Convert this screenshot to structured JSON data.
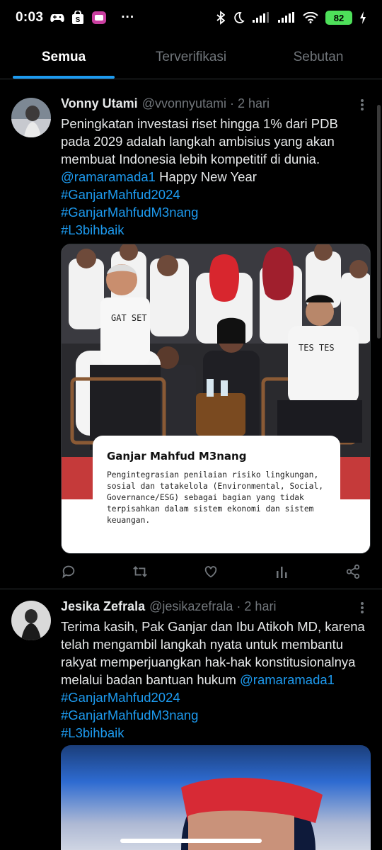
{
  "status_bar": {
    "time": "0:03",
    "battery": "82",
    "overflow": "···"
  },
  "tabs": [
    {
      "label": "Semua",
      "active": true
    },
    {
      "label": "Terverifikasi",
      "active": false
    },
    {
      "label": "Sebutan",
      "active": false
    }
  ],
  "tweets": [
    {
      "name": "Vonny Utami",
      "handle": "@vvonnyutami",
      "time": "2 hari",
      "lines": [
        "Peningkatan investasi riset hingga 1% dari PDB",
        "pada 2029 adalah langkah ambisius yang akan",
        "membuat Indonesia lebih kompetitif di dunia."
      ],
      "mention": "@ramaramada1",
      "after_mention": " Happy New Year",
      "hashtags": [
        "#GanjarMahfud2024",
        "#GanjarMahfudM3nang",
        "#L3bihbaik"
      ],
      "card": {
        "title": "Ganjar Mahfud M3nang",
        "desc": "Pengintegrasian penilaian risiko lingkungan, sosial dan tatakelola (Environmental, Social, Governance/ESG) sebagai bagian yang tidak terpisahkan dalam sistem ekonomi dan sistem keuangan."
      },
      "shirt_left": "GAT SET",
      "shirt_right": "TES TES"
    },
    {
      "name": "Jesika Zefrala",
      "handle": "@jesikazefrala",
      "time": "2 hari",
      "lines": [
        "Terima kasih, Pak Ganjar dan Ibu Atikoh MD, karena",
        "telah mengambil langkah nyata untuk membantu",
        "rakyat memperjuangkan hak-hak konstitusionalnya"
      ],
      "last_line": "melalui badan bantuan hukum ",
      "mention": "@ramaramada1",
      "hashtags": [
        "#GanjarMahfud2024",
        "#GanjarMahfudM3nang",
        "#L3bihbaik"
      ]
    }
  ],
  "icons": {
    "reply": "reply-icon",
    "retweet": "retweet-icon",
    "like": "like-icon",
    "views": "views-icon",
    "share": "share-icon"
  },
  "colors": {
    "link": "#1d9bf0",
    "secondary": "#71767b",
    "battery": "#4ee05a"
  }
}
